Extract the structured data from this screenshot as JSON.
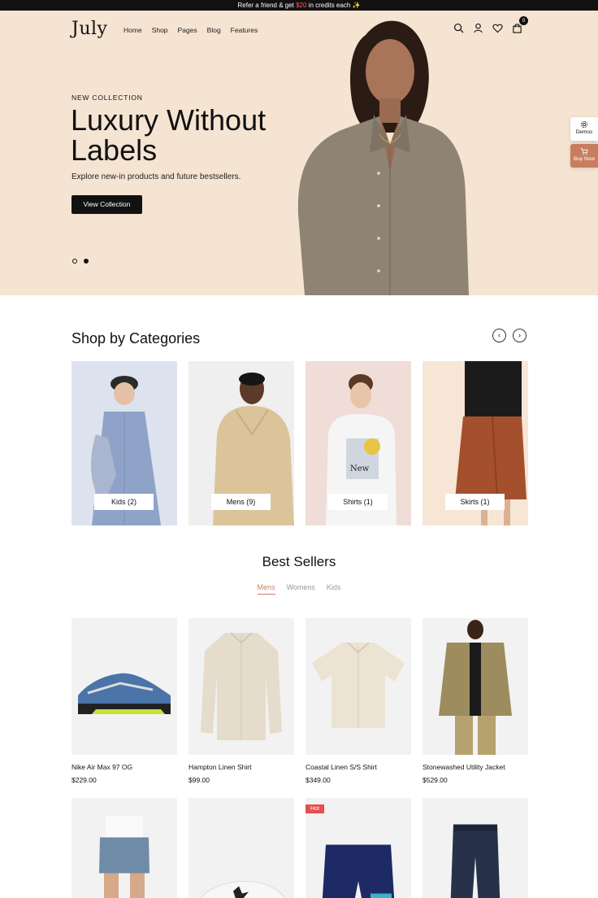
{
  "topbar": {
    "before": "Refer a friend & get ",
    "amount": "$20",
    "after": " in credits each ✨"
  },
  "header": {
    "logo": "July",
    "nav": [
      "Home",
      "Shop",
      "Pages",
      "Blog",
      "Features"
    ],
    "cart_count": "0"
  },
  "hero": {
    "eyebrow": "NEW COLLECTION",
    "headline": "Luxury Without Labels",
    "subline": "Explore new-in products and future bestsellers.",
    "cta": "View Collection",
    "slide_count": 2,
    "active_slide": 2
  },
  "side_tabs": {
    "demos": "Demos",
    "buy": "Buy Now"
  },
  "categories": {
    "title": "Shop by Categories",
    "prev": "‹",
    "next": "›",
    "items": [
      {
        "label": "Kids (2)"
      },
      {
        "label": "Mens (9)"
      },
      {
        "label": "Shirts (1)"
      },
      {
        "label": "Skirts (1)"
      }
    ]
  },
  "best_sellers": {
    "title": "Best Sellers",
    "tabs": [
      "Mens",
      "Womens",
      "Kids"
    ],
    "active_tab": "Mens",
    "products": [
      {
        "name": "Nike Air Max 97 OG",
        "price": "$229.00"
      },
      {
        "name": "Hampton Linen Shirt",
        "price": "$99.00"
      },
      {
        "name": "Coastal Linen S/S Shirt",
        "price": "$349.00"
      },
      {
        "name": "Stonewashed Utility Jacket",
        "price": "$529.00"
      }
    ],
    "row2_badge": "Hot"
  },
  "colors": {
    "accent": "#c97d5f",
    "hero_bg": "#f5e4d2",
    "topbar_bg": "#111111",
    "hot": "#e94d4d"
  }
}
